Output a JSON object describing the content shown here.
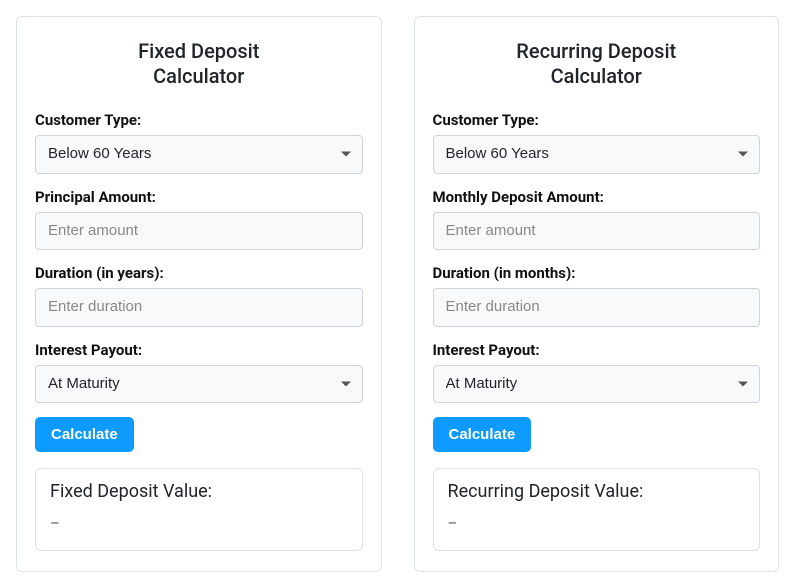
{
  "fd": {
    "title_line1": "Fixed Deposit",
    "title_line2": "Calculator",
    "customer_type_label": "Customer Type:",
    "customer_type_value": "Below 60 Years",
    "principal_label": "Principal Amount:",
    "principal_placeholder": "Enter amount",
    "duration_label": "Duration (in years):",
    "duration_placeholder": "Enter duration",
    "payout_label": "Interest Payout:",
    "payout_value": "At Maturity",
    "calculate_label": "Calculate",
    "result_title": "Fixed Deposit Value:",
    "result_value": "–"
  },
  "rd": {
    "title_line1": "Recurring Deposit",
    "title_line2": "Calculator",
    "customer_type_label": "Customer Type:",
    "customer_type_value": "Below 60 Years",
    "monthly_label": "Monthly Deposit Amount:",
    "monthly_placeholder": "Enter amount",
    "duration_label": "Duration (in months):",
    "duration_placeholder": "Enter duration",
    "payout_label": "Interest Payout:",
    "payout_value": "At Maturity",
    "calculate_label": "Calculate",
    "result_title": "Recurring Deposit Value:",
    "result_value": "–"
  }
}
